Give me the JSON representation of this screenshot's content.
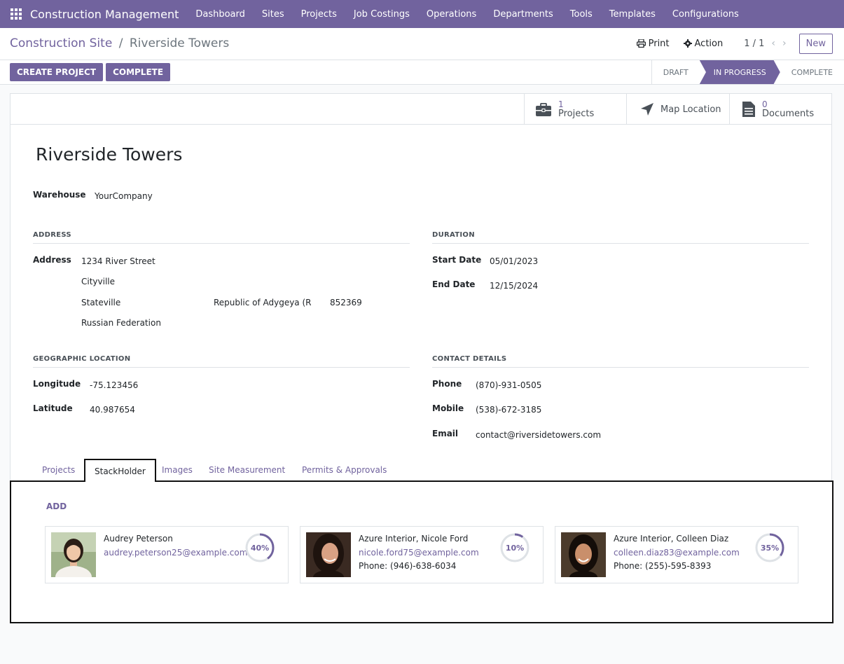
{
  "app": {
    "title": "Construction Management",
    "nav": [
      "Dashboard",
      "Sites",
      "Projects",
      "Job Costings",
      "Operations",
      "Departments",
      "Tools",
      "Templates",
      "Configurations"
    ]
  },
  "breadcrumb": {
    "parent": "Construction Site",
    "separator": "/",
    "current": "Riverside Towers"
  },
  "controls": {
    "print": "Print",
    "action": "Action",
    "pager": "1 / 1",
    "prev": "‹",
    "next": "›",
    "new": "New"
  },
  "actions": {
    "create_project": "CREATE PROJECT",
    "complete": "COMPLETE"
  },
  "status": {
    "stages": [
      "DRAFT",
      "IN PROGRESS",
      "COMPLETE"
    ],
    "active": "IN PROGRESS"
  },
  "smart_buttons": {
    "projects": {
      "count": "1",
      "label": "Projects"
    },
    "map": {
      "label": "Map Location"
    },
    "documents": {
      "count": "0",
      "label": "Documents"
    }
  },
  "record": {
    "name": "Riverside Towers",
    "warehouse_label": "Warehouse",
    "warehouse": "YourCompany",
    "address_section": "ADDRESS",
    "address_label": "Address",
    "street": "1234 River Street",
    "street2": "Cityville",
    "city": "Stateville",
    "state": "Republic of Adygeya (RU)",
    "zip": "852369",
    "country": "Russian Federation",
    "duration_section": "DURATION",
    "start_label": "Start Date",
    "start_date": "05/01/2023",
    "end_label": "End Date",
    "end_date": "12/15/2024",
    "geo_section": "GEOGRAPHIC LOCATION",
    "longitude_label": "Longitude",
    "longitude": "-75.123456",
    "latitude_label": "Latitude",
    "latitude": "40.987654",
    "contact_section": "CONTACT DETAILS",
    "phone_label": "Phone",
    "phone": "(870)-931-0505",
    "mobile_label": "Mobile",
    "mobile": "(538)-672-3185",
    "email_label": "Email",
    "email": "contact@riversidetowers.com"
  },
  "tabs": [
    "Projects",
    "StackHolder",
    "Images",
    "Site Measurement",
    "Permits & Approvals"
  ],
  "active_tab": "StackHolder",
  "stakeholders": {
    "add": "ADD",
    "cards": [
      {
        "name": "Audrey Peterson",
        "email": "audrey.peterson25@example.com",
        "phone": "",
        "percent": "40%",
        "fraction": 0.4
      },
      {
        "name": "Azure Interior, Nicole Ford",
        "email": "nicole.ford75@example.com",
        "phone": "Phone: (946)-638-6034",
        "percent": "10%",
        "fraction": 0.1
      },
      {
        "name": "Azure Interior, Colleen Diaz",
        "email": "colleen.diaz83@example.com",
        "phone": "Phone: (255)-595-8393",
        "percent": "35%",
        "fraction": 0.35
      }
    ]
  },
  "colors": {
    "brand": "#71639e"
  }
}
